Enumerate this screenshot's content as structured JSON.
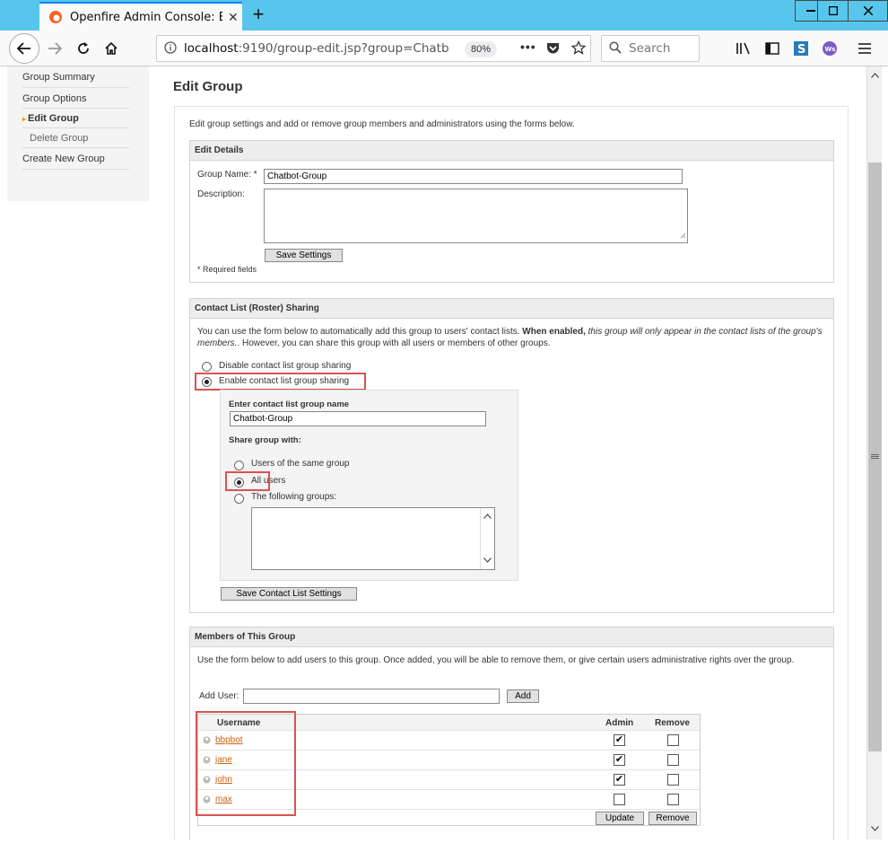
{
  "browser": {
    "tab_title": "Openfire Admin Console: Edit G",
    "url_host": "localhost",
    "url_rest": ":9190/group-edit.jsp?group=Chatb",
    "zoom": "80%",
    "search_placeholder": "Search"
  },
  "sidebar": {
    "items": [
      {
        "label": "Group Summary"
      },
      {
        "label": "Group Options"
      },
      {
        "label": "Edit Group"
      },
      {
        "label": "Delete Group"
      },
      {
        "label": "Create New Group"
      }
    ]
  },
  "page": {
    "title": "Edit Group",
    "intro": "Edit group settings and add or remove group members and administrators using the forms below."
  },
  "edit_details": {
    "header": "Edit Details",
    "group_name_label": "Group Name: *",
    "group_name_value": "Chatbot-Group",
    "description_label": "Description:",
    "save_button": "Save Settings",
    "required_note": "* Required fields"
  },
  "sharing": {
    "header": "Contact List (Roster) Sharing",
    "para_1": "You can use the form below to automatically add this group to users' contact lists.",
    "para_bold": "When enabled,",
    "para_italic": "this group will only appear in the contact lists of the group's members.",
    "para_2": ". However, you can share this group with all users or members of other groups.",
    "disable_label": "Disable contact list group sharing",
    "enable_label": "Enable contact list group sharing",
    "group_name_prompt": "Enter contact list group name",
    "group_name_value": "Chatbot-Group",
    "share_with_label": "Share group with:",
    "opt_same_group": "Users of the same group",
    "opt_all_users": "All users",
    "opt_following": "The following groups:",
    "save_button": "Save Contact List Settings"
  },
  "members": {
    "header": "Members of This Group",
    "para": "Use the form below to add users to this group. Once added, you will be able to remove them, or give certain users administrative rights over the group.",
    "add_user_label": "Add User:",
    "add_button": "Add",
    "col_username": "Username",
    "col_admin": "Admin",
    "col_remove": "Remove",
    "rows": [
      {
        "username": "bbpbot",
        "admin": true,
        "remove": false
      },
      {
        "username": "jane",
        "admin": true,
        "remove": false
      },
      {
        "username": "john",
        "admin": true,
        "remove": false
      },
      {
        "username": "max",
        "admin": false,
        "remove": false
      }
    ],
    "update_button": "Update",
    "remove_button": "Remove"
  },
  "colors": {
    "highlight": "#d9534f",
    "link": "#c7620f",
    "tabbar": "#58c6ec"
  }
}
